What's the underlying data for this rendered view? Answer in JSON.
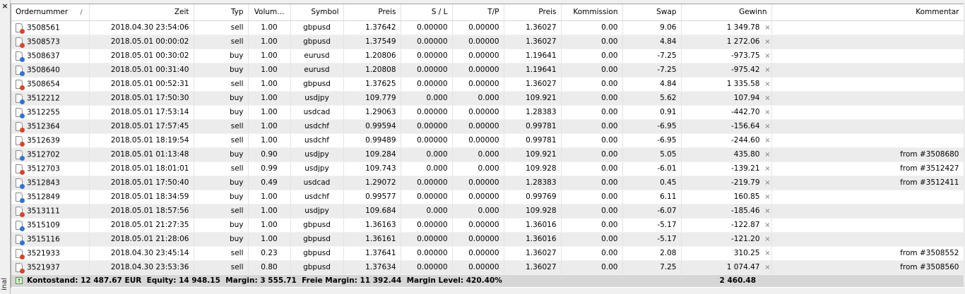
{
  "window": {
    "close_glyph": "×",
    "side_tab_label": "inal"
  },
  "colors": {
    "sell_dot": "#d8452c",
    "buy_dot": "#2f74d0",
    "row_alt": "#ececec",
    "summary_bg": "#d6d6d6"
  },
  "table": {
    "headers": {
      "order": "Ordernummer",
      "sort_marker": "/",
      "time": "Zeit",
      "type": "Typ",
      "volume": "Volum...",
      "symbol": "Symbol",
      "price_open": "Preis",
      "sl": "S / L",
      "tp": "T/P",
      "price_current": "Preis",
      "commission": "Kommission",
      "swap": "Swap",
      "profit": "Gewinn",
      "comment": "Kommentar"
    },
    "rows": [
      {
        "order": "3508561",
        "time": "2018.04.30 23:54:06",
        "type": "sell",
        "volume": "1.00",
        "symbol": "gbpusd",
        "price_open": "1.37642",
        "sl": "0.00000",
        "tp": "0.00000",
        "price_current": "1.36027",
        "commission": "0.00",
        "swap": "9.06",
        "profit": "1 349.78",
        "comment": ""
      },
      {
        "order": "3508573",
        "time": "2018.05.01 00:00:02",
        "type": "sell",
        "volume": "1.00",
        "symbol": "gbpusd",
        "price_open": "1.37549",
        "sl": "0.00000",
        "tp": "0.00000",
        "price_current": "1.36027",
        "commission": "0.00",
        "swap": "4.84",
        "profit": "1 272.06",
        "comment": ""
      },
      {
        "order": "3508637",
        "time": "2018.05.01 00:30:02",
        "type": "buy",
        "volume": "1.00",
        "symbol": "eurusd",
        "price_open": "1.20806",
        "sl": "0.00000",
        "tp": "0.00000",
        "price_current": "1.19641",
        "commission": "0.00",
        "swap": "-7.25",
        "profit": "-973.75",
        "comment": ""
      },
      {
        "order": "3508640",
        "time": "2018.05.01 00:31:40",
        "type": "buy",
        "volume": "1.00",
        "symbol": "eurusd",
        "price_open": "1.20808",
        "sl": "0.00000",
        "tp": "0.00000",
        "price_current": "1.19641",
        "commission": "0.00",
        "swap": "-7.25",
        "profit": "-975.42",
        "comment": ""
      },
      {
        "order": "3508654",
        "time": "2018.05.01 00:52:31",
        "type": "sell",
        "volume": "1.00",
        "symbol": "gbpusd",
        "price_open": "1.37625",
        "sl": "0.00000",
        "tp": "0.00000",
        "price_current": "1.36027",
        "commission": "0.00",
        "swap": "4.84",
        "profit": "1 335.58",
        "comment": ""
      },
      {
        "order": "3512212",
        "time": "2018.05.01 17:50:30",
        "type": "buy",
        "volume": "1.00",
        "symbol": "usdjpy",
        "price_open": "109.779",
        "sl": "0.000",
        "tp": "0.000",
        "price_current": "109.921",
        "commission": "0.00",
        "swap": "5.62",
        "profit": "107.94",
        "comment": ""
      },
      {
        "order": "3512255",
        "time": "2018.05.01 17:53:14",
        "type": "buy",
        "volume": "1.00",
        "symbol": "usdcad",
        "price_open": "1.29063",
        "sl": "0.00000",
        "tp": "0.00000",
        "price_current": "1.28383",
        "commission": "0.00",
        "swap": "0.91",
        "profit": "-442.70",
        "comment": ""
      },
      {
        "order": "3512364",
        "time": "2018.05.01 17:57:45",
        "type": "sell",
        "volume": "1.00",
        "symbol": "usdchf",
        "price_open": "0.99594",
        "sl": "0.00000",
        "tp": "0.00000",
        "price_current": "0.99781",
        "commission": "0.00",
        "swap": "-6.95",
        "profit": "-156.64",
        "comment": ""
      },
      {
        "order": "3512639",
        "time": "2018.05.01 18:19:54",
        "type": "sell",
        "volume": "1.00",
        "symbol": "usdchf",
        "price_open": "0.99489",
        "sl": "0.00000",
        "tp": "0.00000",
        "price_current": "0.99781",
        "commission": "0.00",
        "swap": "-6.95",
        "profit": "-244.60",
        "comment": ""
      },
      {
        "order": "3512702",
        "time": "2018.05.01 01:13:48",
        "type": "buy",
        "volume": "0.90",
        "symbol": "usdjpy",
        "price_open": "109.284",
        "sl": "0.000",
        "tp": "0.000",
        "price_current": "109.921",
        "commission": "0.00",
        "swap": "5.05",
        "profit": "435.80",
        "comment": "from #3508680"
      },
      {
        "order": "3512703",
        "time": "2018.05.01 18:01:01",
        "type": "sell",
        "volume": "0.99",
        "symbol": "usdjpy",
        "price_open": "109.743",
        "sl": "0.000",
        "tp": "0.000",
        "price_current": "109.928",
        "commission": "0.00",
        "swap": "-6.01",
        "profit": "-139.21",
        "comment": "from #3512427"
      },
      {
        "order": "3512843",
        "time": "2018.05.01 17:50:40",
        "type": "buy",
        "volume": "0.49",
        "symbol": "usdcad",
        "price_open": "1.29072",
        "sl": "0.00000",
        "tp": "0.00000",
        "price_current": "1.28383",
        "commission": "0.00",
        "swap": "0.45",
        "profit": "-219.79",
        "comment": "from #3512411"
      },
      {
        "order": "3512849",
        "time": "2018.05.01 18:34:59",
        "type": "buy",
        "volume": "1.00",
        "symbol": "usdchf",
        "price_open": "0.99577",
        "sl": "0.00000",
        "tp": "0.00000",
        "price_current": "0.99769",
        "commission": "0.00",
        "swap": "6.11",
        "profit": "160.85",
        "comment": ""
      },
      {
        "order": "3513111",
        "time": "2018.05.01 18:57:56",
        "type": "sell",
        "volume": "1.00",
        "symbol": "usdjpy",
        "price_open": "109.684",
        "sl": "0.000",
        "tp": "0.000",
        "price_current": "109.928",
        "commission": "0.00",
        "swap": "-6.07",
        "profit": "-185.46",
        "comment": ""
      },
      {
        "order": "3515109",
        "time": "2018.05.01 21:27:35",
        "type": "buy",
        "volume": "1.00",
        "symbol": "gbpusd",
        "price_open": "1.36163",
        "sl": "0.00000",
        "tp": "0.00000",
        "price_current": "1.36016",
        "commission": "0.00",
        "swap": "-5.17",
        "profit": "-122.87",
        "comment": ""
      },
      {
        "order": "3515116",
        "time": "2018.05.01 21:28:06",
        "type": "buy",
        "volume": "1.00",
        "symbol": "gbpusd",
        "price_open": "1.36161",
        "sl": "0.00000",
        "tp": "0.00000",
        "price_current": "1.36016",
        "commission": "0.00",
        "swap": "-5.17",
        "profit": "-121.20",
        "comment": ""
      },
      {
        "order": "3521933",
        "time": "2018.04.30 23:45:14",
        "type": "sell",
        "volume": "0.23",
        "symbol": "gbpusd",
        "price_open": "1.37641",
        "sl": "0.00000",
        "tp": "0.00000",
        "price_current": "1.36027",
        "commission": "0.00",
        "swap": "2.08",
        "profit": "310.25",
        "comment": "from #3508552"
      },
      {
        "order": "3521937",
        "time": "2018.04.30 23:53:36",
        "type": "sell",
        "volume": "0.80",
        "symbol": "gbpusd",
        "price_open": "1.37634",
        "sl": "0.00000",
        "tp": "0.00000",
        "price_current": "1.36027",
        "commission": "0.00",
        "swap": "7.25",
        "profit": "1 074.47",
        "comment": "from #3508560"
      }
    ],
    "close_glyph": "×"
  },
  "summary": {
    "text": "Kontostand: 12 487.67 EUR  Equity: 14 948.15  Margin: 3 555.71  Freie Margin: 11 392.44  Margin Level: 420.40%",
    "total_profit": "2 460.48",
    "icon_glyph": "↑"
  }
}
